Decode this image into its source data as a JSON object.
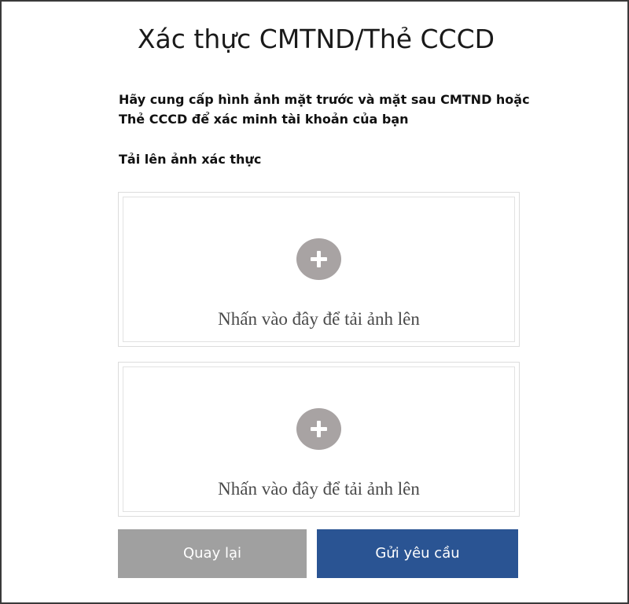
{
  "page": {
    "title": "Xác thực CMTND/Thẻ CCCD",
    "intro_line1": "Hãy cung cấp hình ảnh mặt trước và mặt sau CMTND hoặc",
    "intro_line2": "Thẻ CCCD để xác minh tài khoản của bạn",
    "upload_heading": "Tải lên ảnh xác thực"
  },
  "uploads": [
    {
      "label": "Nhấn vào đây để tải ảnh lên",
      "icon": "plus-icon"
    },
    {
      "label": "Nhấn vào đây để tải ảnh lên",
      "icon": "plus-icon"
    }
  ],
  "buttons": {
    "back_label": "Quay lại",
    "submit_label": "Gửi yêu cầu"
  },
  "colors": {
    "back_button": "#a0a0a0",
    "submit_button": "#2a5493",
    "plus_circle": "#a8a3a3"
  }
}
